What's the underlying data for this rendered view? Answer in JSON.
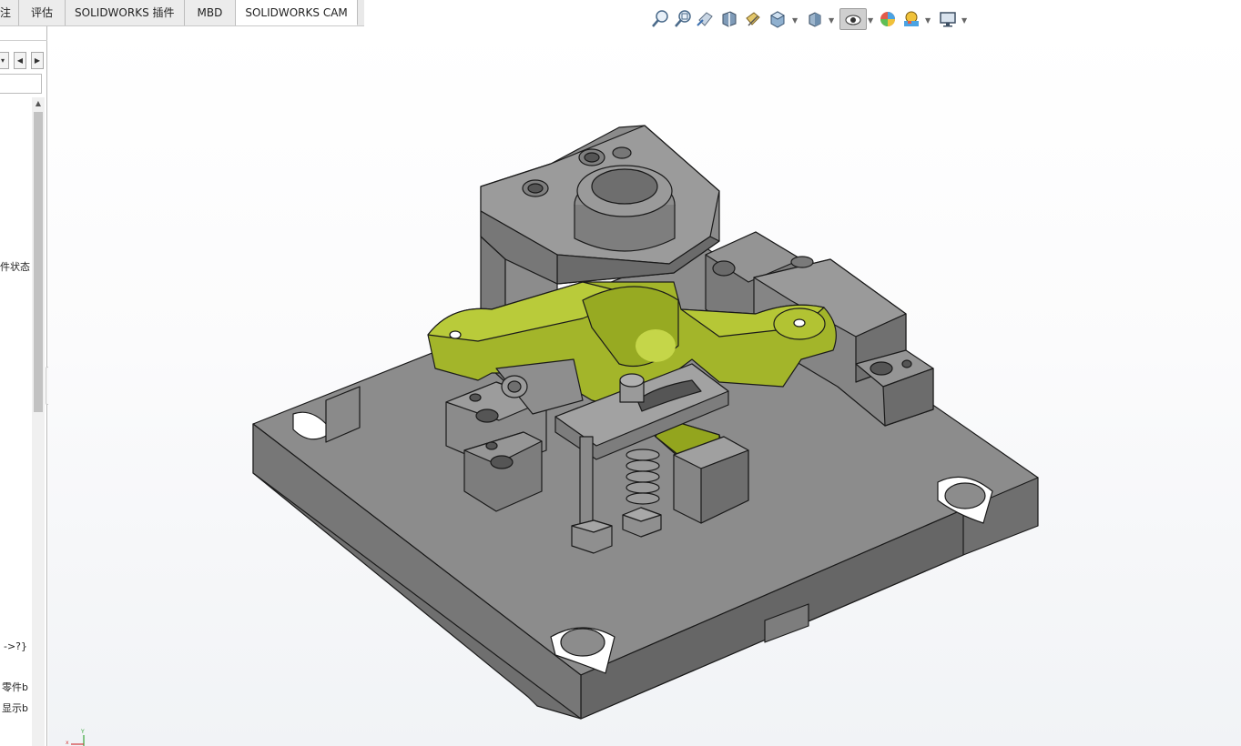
{
  "tabs": [
    {
      "label": "标注",
      "active": false
    },
    {
      "label": "评估",
      "active": false
    },
    {
      "label": "SOLIDWORKS 插件",
      "active": false
    },
    {
      "label": "MBD",
      "active": false
    },
    {
      "label": "SOLIDWORKS CAM",
      "active": true
    }
  ],
  "left_panel": {
    "items": [
      {
        "label": "件状态"
      },
      {
        "label": "->?}"
      },
      {
        "label": "零件b"
      },
      {
        "label": "显示b"
      }
    ]
  },
  "toolbar": {
    "icons": [
      "zoom-to-fit-icon",
      "zoom-to-area-icon",
      "previous-view-icon",
      "section-view-icon",
      "dynamic-annotation-icon",
      "view-orientation-icon",
      "display-style-icon",
      "hide-show-items-icon",
      "edit-appearance-icon",
      "apply-scene-icon",
      "view-settings-icon"
    ]
  },
  "colors": {
    "part_grey": "#8b8b8b",
    "part_green": "#a3b52a",
    "edge": "#1a1a1a",
    "viewport_bg": "#f6f7f9"
  },
  "viewport": {
    "model": "fixture-assembly"
  }
}
